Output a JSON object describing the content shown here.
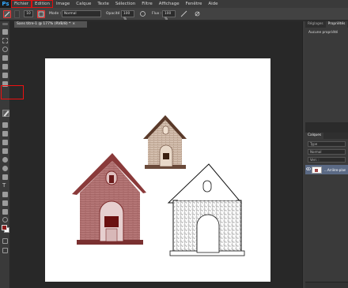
{
  "app": {
    "logo": "Ps"
  },
  "menubar": {
    "items": [
      "Fichier",
      "Edition",
      "Image",
      "Calque",
      "Texte",
      "Sélection",
      "Filtre",
      "Affichage",
      "Fenêtre",
      "Aide"
    ]
  },
  "options": {
    "size_value": "10",
    "mode_label": "Mode :",
    "mode_value": "Normal",
    "opacity_label": "Opacité :",
    "opacity_value": "100 %",
    "flow_label": "Flux :",
    "flow_value": "100 %"
  },
  "document": {
    "tab_label": "Sans titre-1 @ 177% (RVB/8) *",
    "tab_close": "×"
  },
  "panels": {
    "top_tabs": [
      "Réglages",
      "Propriétés"
    ],
    "properties_text": "Aucune propriété",
    "layers_tab": "Calques",
    "layers_filter": "Type",
    "layers_blend": "Normal",
    "layers_lock": "Verr. :",
    "layer_name": "...Arrière-plan"
  },
  "colors": {
    "accent": "#31a8ff",
    "highlight_red": "#e11111",
    "foreground_swatch": "#8b1a1a",
    "house_tint": "#a04848"
  },
  "icons": {
    "brush": "brush-icon",
    "eye": "eye-icon"
  }
}
